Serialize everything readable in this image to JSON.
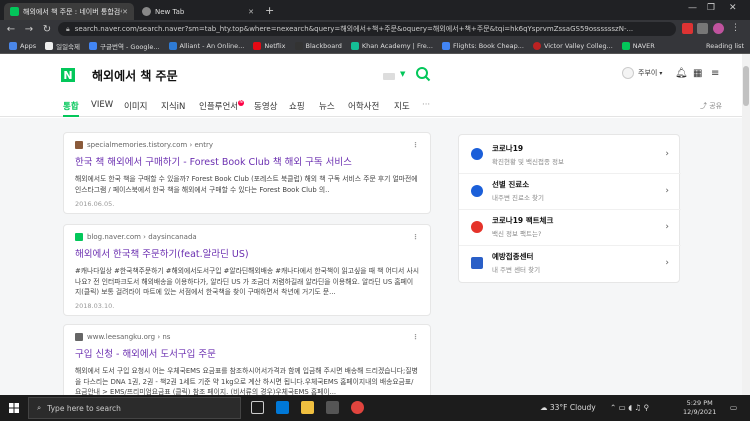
{
  "browser": {
    "tabs": [
      {
        "title": "해외에서 책 주문 : 네이버 통합검색",
        "active": true
      },
      {
        "title": "New Tab",
        "active": false
      }
    ],
    "new_tab_symbol": "+",
    "url": "search.naver.com/search.naver?sm=tab_hty.top&where=nexearch&query=해외에서+책+주문&oquery=해외에서+책+주문&tqi=hk6qYsprvmZssaGS59osssssszN-...",
    "bookmarks": [
      "Apps",
      "일일숙제",
      "구글번역 - Google...",
      "Alliant - An Online...",
      "Netflix",
      "Blackboard",
      "Khan Academy | Fre...",
      "Flights: Book Cheap...",
      "Victor Valley Colleg...",
      "NAVER"
    ],
    "reading_list": "Reading list"
  },
  "naver": {
    "logo": "N",
    "query": "해외에서 책 주문",
    "user_name": "주부이",
    "tabs": [
      "통합",
      "VIEW",
      "이미지",
      "지식iN",
      "인플루언서",
      "동영상",
      "쇼핑",
      "뉴스",
      "어학사전",
      "지도",
      "···"
    ],
    "influencer_badge": "N",
    "share_label": "공유"
  },
  "results": [
    {
      "source": "specialmemories.tistory.com",
      "category": "entry",
      "title": "한국 책 해외에서 구매하기 - Forest Book Club 책 해외 구독 서비스",
      "description": "해외에서도 한국 책을 구매할 수 있을까? Forest Book Club (포레스트 북클럽) 해외 책 구독 서비스 주문 후기 얼마전에 인스타그램 / 페이스북에서 한국 책을 해외에서 구매할 수 있다는 Forest Book Club 의..",
      "date": "2016.06.05.",
      "favicon_color": "#8a5a3a"
    },
    {
      "source": "blog.naver.com",
      "category": "daysincanada",
      "title": "해외에서 한국책 주문하기(feat.알라딘 US)",
      "description": "#캐나다일상 #한국책주문하기 #해외에서도서구입 #알라딘해외배송 #캐나다에서 한국책이 읽고싶을 때 책 어디서 사시나요? 전 인터파크도서 해외배송을 이용하다가, 알라딘 US 가 조금더 저렴하길래 알라딘을 이용해요. 알라딘 US 홈페이지(클릭) 보통 걸려라이 마트에 있는 서점에서 한국책을 찾이 구매하면서 착년에 거기도 문...",
      "date": "2018.03.10.",
      "favicon_color": "#03c75a"
    },
    {
      "source": "www.leesangku.org",
      "category": "ns",
      "title": "구입 신청 - 해외에서 도서구입 주문",
      "description": "해외에서 도서 구입 요청시 어는 우체국EMS 요금표를 참조하시어서가격과 함께 입금해 주시면 배송해 드리겠습니다;질병을 다스리는 DNA 1권, 2권 - 책2권 1세트 기준 약 1kg으로 계산 하시면 됩니다.우체국EMS 홈페이지내의 배송요금표/요금안내 > EMS/프리미엄요금표 (클릭) 참조 페이지. (비서류의 경우)우체국EMS 홈페이...",
      "favicon_color": "#666666"
    }
  ],
  "side_panel": [
    {
      "title": "코로나19",
      "subtitle": "확진현황 및 백신접종 정보",
      "icon_color": "#1b5fd9"
    },
    {
      "title": "선별 진료소",
      "subtitle": "내주변 진료소 찾기",
      "icon_color": "#1b5fd9"
    },
    {
      "title": "코로나19 팩트체크",
      "subtitle": "백신 정보 팩트는?",
      "icon_color": "#e5332a"
    },
    {
      "title": "예방접종센터",
      "subtitle": "내 주변 센터 찾기",
      "icon_color": "#2a5fc7"
    }
  ],
  "taskbar": {
    "search_placeholder": "Type here to search",
    "weather": "33°F  Cloudy",
    "time": "5:29 PM",
    "date": "12/9/2021"
  }
}
